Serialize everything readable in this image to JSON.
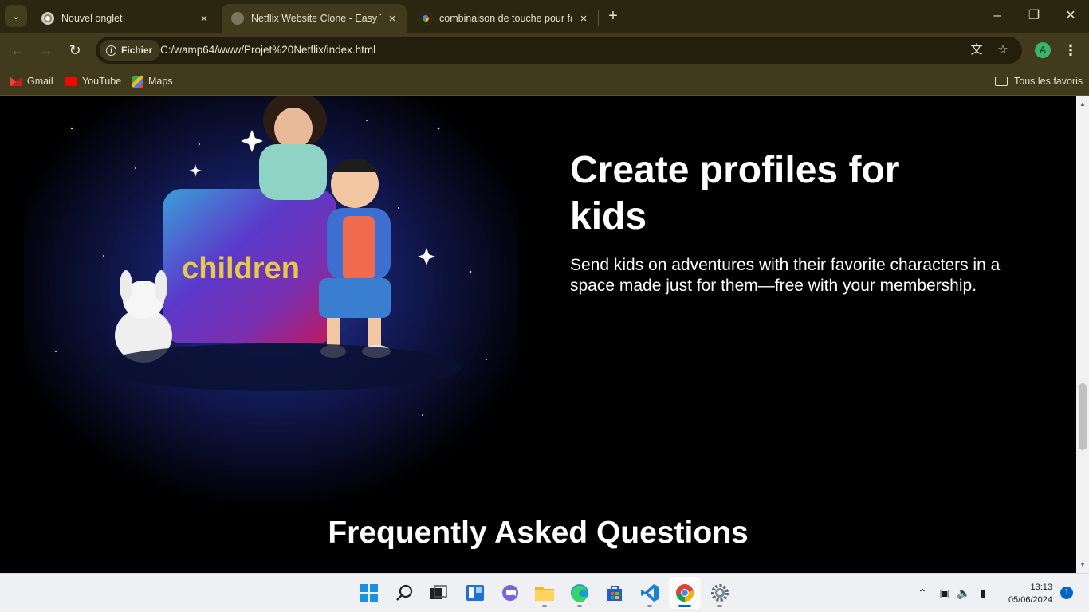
{
  "browser": {
    "tabs": [
      {
        "title": "Nouvel onglet",
        "active": false
      },
      {
        "title": "Netflix Website Clone - Easy Tut",
        "active": true
      },
      {
        "title": "combinaison de touche pour faire",
        "active": false
      }
    ],
    "address": {
      "chip_label": "Fichier",
      "url": "C:/wamp64/www/Projet%20Netflix/index.html"
    },
    "profile_initial": "A",
    "bookmarks": [
      {
        "label": "Gmail",
        "icon": "gmail-icon"
      },
      {
        "label": "YouTube",
        "icon": "youtube-icon"
      },
      {
        "label": "Maps",
        "icon": "maps-icon"
      }
    ],
    "all_bookmarks_label": "Tous les favoris"
  },
  "page": {
    "art_label": "children",
    "headline": "Create profiles for kids",
    "description": "Send kids on adventures with their favorite characters in a space made just for them—free with your membership.",
    "faq_title": "Frequently Asked Questions"
  },
  "taskbar": {
    "apps": [
      "windows-start-icon",
      "search-icon",
      "task-view-icon",
      "widgets-icon",
      "teams-chat-icon",
      "file-explorer-icon",
      "edge-icon",
      "store-icon",
      "vscode-icon",
      "chrome-icon",
      "settings-icon"
    ],
    "active_app": "chrome-icon",
    "time": "13:13",
    "date": "05/06/2024",
    "notification_count": "1"
  },
  "colors": {
    "chrome_frame": "#2b2610",
    "chrome_toolbar": "#413a1d",
    "page_background": "#000000",
    "taskbar": "#eef0f4",
    "accent": "#0067c0"
  }
}
